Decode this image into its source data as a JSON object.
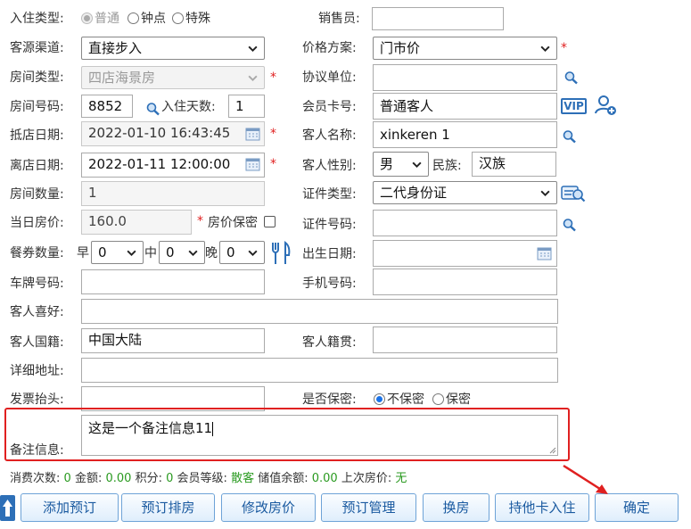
{
  "form": {
    "checkin_type": {
      "label": "入住类型:",
      "options": [
        "普通",
        "钟点",
        "特殊"
      ],
      "selected": "普通"
    },
    "salesperson": {
      "label": "销售员:",
      "value": ""
    },
    "source_channel": {
      "label": "客源渠道:",
      "value": "直接步入"
    },
    "price_plan": {
      "label": "价格方案:",
      "value": "门市价"
    },
    "room_type": {
      "label": "房间类型:",
      "value": "四店海景房"
    },
    "agreement_unit": {
      "label": "协议单位:",
      "value": ""
    },
    "room_number": {
      "label": "房间号码:",
      "value": "8852"
    },
    "stay_days": {
      "label": "入住天数:",
      "value": "1"
    },
    "member_card": {
      "label": "会员卡号:",
      "value": "普通客人"
    },
    "vip_badge": "VIP",
    "arrival_date": {
      "label": "抵店日期:",
      "value": "2022-01-10 16:43:45"
    },
    "guest_name": {
      "label": "客人名称:",
      "value": "xinkeren 1"
    },
    "departure_date": {
      "label": "离店日期:",
      "value": "2022-01-11 12:00:00"
    },
    "guest_gender": {
      "label": "客人性别:",
      "value": "男"
    },
    "ethnicity": {
      "label": "民族:",
      "value": "汉族"
    },
    "room_count": {
      "label": "房间数量:",
      "value": "1"
    },
    "id_type": {
      "label": "证件类型:",
      "value": "二代身份证"
    },
    "daily_price": {
      "label": "当日房价:",
      "value": "160.0"
    },
    "price_secret": {
      "label": "房价保密"
    },
    "id_number": {
      "label": "证件号码:",
      "value": ""
    },
    "meal_coupons": {
      "label": "餐券数量:",
      "breakfast_label": "早",
      "breakfast": "0",
      "lunch_label": "中",
      "lunch": "0",
      "dinner_label": "晚",
      "dinner": "0"
    },
    "birth_date": {
      "label": "出生日期:",
      "value": ""
    },
    "plate_number": {
      "label": "车牌号码:",
      "value": ""
    },
    "phone": {
      "label": "手机号码:",
      "value": ""
    },
    "preferences": {
      "label": "客人喜好:",
      "value": ""
    },
    "nationality": {
      "label": "客人国籍:",
      "value": "中国大陆"
    },
    "native_place": {
      "label": "客人籍贯:",
      "value": ""
    },
    "address": {
      "label": "详细地址:",
      "value": ""
    },
    "invoice_title": {
      "label": "发票抬头:",
      "value": ""
    },
    "confidential": {
      "label": "是否保密:",
      "options": [
        "不保密",
        "保密"
      ],
      "selected": "不保密"
    },
    "remarks": {
      "label": "备注信息:",
      "value": "这是一个备注信息11"
    }
  },
  "stats": {
    "visits_label": "消费次数:",
    "visits": "0",
    "amount_label": "金额:",
    "amount": "0.00",
    "points_label": "积分:",
    "points": "0",
    "level_label": "会员等级:",
    "level": "散客",
    "balance_label": "储值余额:",
    "balance": "0.00",
    "last_price_label": "上次房价:",
    "last_price": "无"
  },
  "buttons": {
    "add_reservation": "添加预订",
    "reservation_schedule": "预订排房",
    "modify_price": "修改房价",
    "reservation_manage": "预订管理",
    "change_room": "换房",
    "other_card_checkin": "持他卡入住",
    "confirm": "确定"
  },
  "colors": {
    "accent": "#1a73e8",
    "button_text": "#1a5aa0",
    "value_green": "#2a9a20",
    "highlight_red": "#e02020",
    "required": "#e02020"
  }
}
